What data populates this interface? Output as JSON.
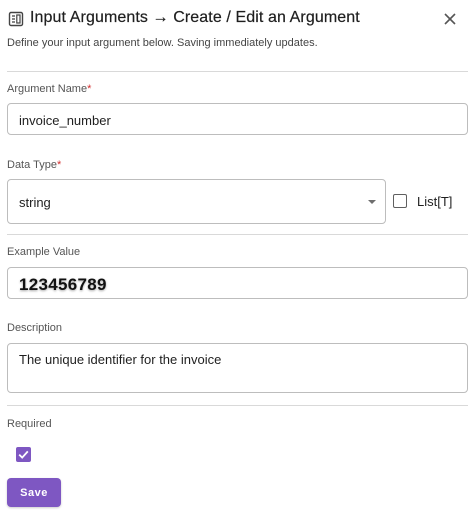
{
  "dialog": {
    "title": "Input Arguments → Create / Edit an Argument",
    "subtitle": "Define your input argument below. Saving immediately updates.",
    "icon": "document-table-icon",
    "close_icon": "close-icon"
  },
  "form": {
    "argument_name": {
      "label": "Argument Name",
      "required_mark": "*",
      "value": "invoice_number"
    },
    "data_type": {
      "label": "Data Type",
      "required_mark": "*",
      "value": "string",
      "list_label": "List[T]",
      "list_checked": false
    },
    "example_value": {
      "label": "Example Value",
      "value": "123456789"
    },
    "description": {
      "label": "Description",
      "value": "The unique identifier for the invoice"
    },
    "required": {
      "label": "Required",
      "checked": true
    }
  },
  "actions": {
    "save_label": "Save"
  },
  "colors": {
    "accent": "#7e57c2",
    "required_mark": "#d32f2f",
    "border": "#bdbdbd"
  }
}
